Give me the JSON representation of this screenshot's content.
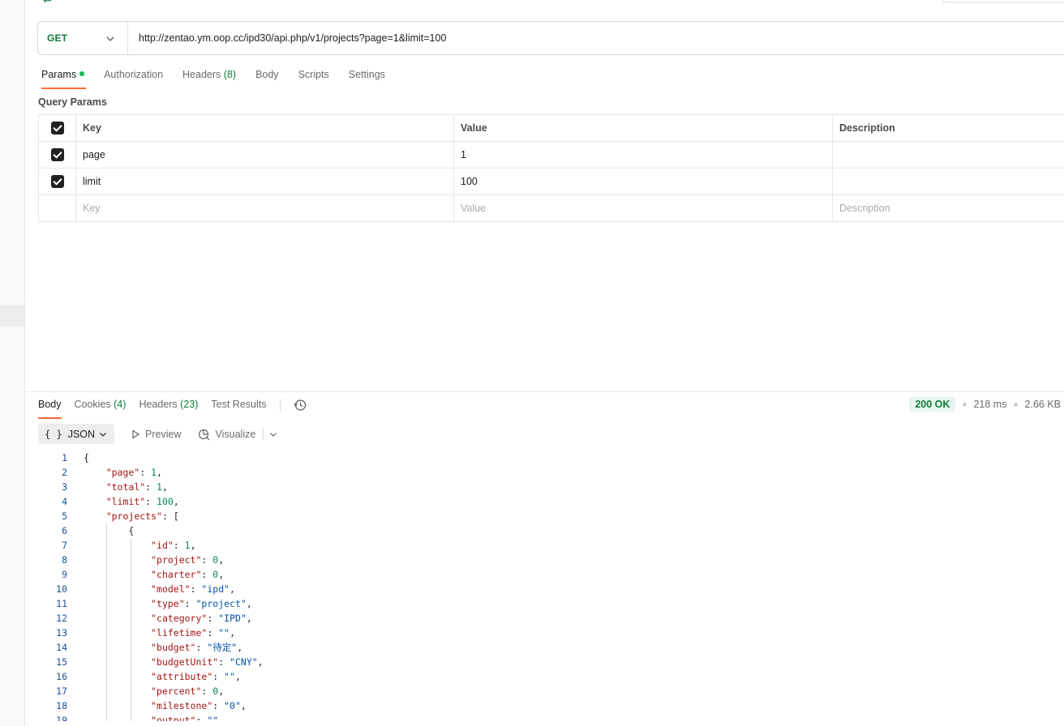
{
  "request": {
    "method": "GET",
    "url": "http://zentao.ym.oop.cc/ipd30/api.php/v1/projects?page=1&limit=100",
    "tabs": [
      {
        "label": "Params",
        "count": ""
      },
      {
        "label": "Authorization",
        "count": ""
      },
      {
        "label": "Headers",
        "count": "(8)"
      },
      {
        "label": "Body",
        "count": ""
      },
      {
        "label": "Scripts",
        "count": ""
      },
      {
        "label": "Settings",
        "count": ""
      }
    ],
    "active_tab": "Params"
  },
  "query_params": {
    "title": "Query Params",
    "headers": {
      "key": "Key",
      "value": "Value",
      "description": "Description"
    },
    "rows": [
      {
        "key": "page",
        "value": "1",
        "description": "",
        "checked": true
      },
      {
        "key": "limit",
        "value": "100",
        "description": "",
        "checked": true
      }
    ],
    "placeholders": {
      "key": "Key",
      "value": "Value",
      "description": "Description"
    }
  },
  "response": {
    "tabs": [
      {
        "label": "Body",
        "count": ""
      },
      {
        "label": "Cookies",
        "count": "(4)"
      },
      {
        "label": "Headers",
        "count": "(23)"
      },
      {
        "label": "Test Results",
        "count": ""
      }
    ],
    "active_tab": "Body",
    "status": "200 OK",
    "time": "218 ms",
    "size": "2.66 KB",
    "format": "JSON",
    "preview_label": "Preview",
    "visualize_label": "Visualize",
    "body_lines": [
      "{",
      "    \"page\": 1,",
      "    \"total\": 1,",
      "    \"limit\": 100,",
      "    \"projects\": [",
      "        {",
      "            \"id\": 1,",
      "            \"project\": 0,",
      "            \"charter\": 0,",
      "            \"model\": \"ipd\",",
      "            \"type\": \"project\",",
      "            \"category\": \"IPD\",",
      "            \"lifetime\": \"\",",
      "            \"budget\": \"待定\",",
      "            \"budgetUnit\": \"CNY\",",
      "            \"attribute\": \"\",",
      "            \"percent\": 0,",
      "            \"milestone\": \"0\",",
      "            \"output\": \"\","
    ]
  },
  "colors": {
    "accent": "#ff6c37",
    "method_green": "#0f7b3c",
    "status_bg": "#e6f6ec",
    "json_key": "#a31515",
    "json_string": "#0451a5",
    "json_number": "#098658"
  },
  "icons": [
    "back-arrow-icon",
    "chevron-down-icon",
    "checkbox-checked-icon",
    "history-icon",
    "play-icon",
    "visualize-icon"
  ]
}
